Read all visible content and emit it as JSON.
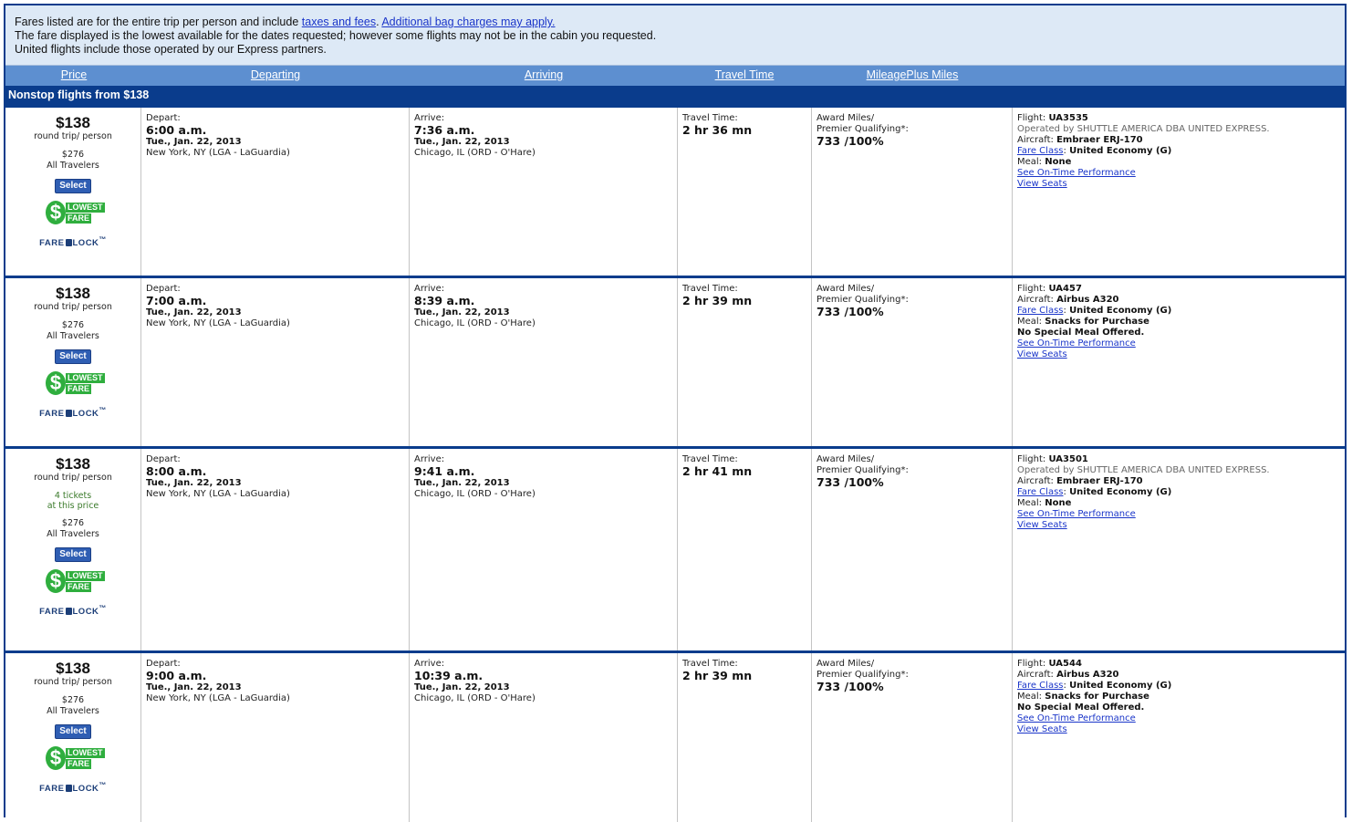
{
  "notice": {
    "line1_prefix": "Fares listed are for the entire trip per person and include ",
    "taxes_link": "taxes and fees",
    "line1_middle": ". ",
    "bag_link": "Additional bag charges may apply.",
    "line2": "The fare displayed is the lowest available for the dates requested; however some flights may not be in the cabin you requested.",
    "line3": "United flights include those operated by our Express partners."
  },
  "sort": {
    "price": "Price",
    "departing": "Departing",
    "arriving": "Arriving",
    "travel_time": "Travel Time",
    "miles": "MileagePlus Miles"
  },
  "section_title": "Nonstop flights from $138",
  "labels": {
    "per_person": "round trip/ person",
    "all_travelers": "All Travelers",
    "select": "Select",
    "lowest": "LOWEST",
    "fare": "FARE",
    "farelock_a": "FARE",
    "farelock_b": "LOCK",
    "farelock_tm": "™",
    "depart": "Depart:",
    "arrive": "Arrive:",
    "travel_time": "Travel Time:",
    "award_miles": "Award Miles/",
    "premier_qualifying": "Premier Qualifying*:",
    "flight": "Flight:",
    "aircraft": "Aircraft:",
    "fare_class": "Fare Class",
    "meal": "Meal:",
    "on_time": "See On-Time Performance",
    "view_seats": "View Seats"
  },
  "flights": [
    {
      "price": "$138",
      "total": "$276",
      "tickets_line1": "",
      "tickets_line2": "",
      "depart_time": "6:00 a.m.",
      "depart_date": "Tue., Jan. 22, 2013",
      "depart_airport": "New York, NY (LGA - LaGuardia)",
      "arrive_time": "7:36 a.m.",
      "arrive_date": "Tue., Jan. 22, 2013",
      "arrive_airport": "Chicago, IL (ORD - O'Hare)",
      "travel_time": "2 hr 36 mn",
      "miles": "733 /100%",
      "flight": "UA3535",
      "operated_by": "Operated by SHUTTLE AMERICA DBA UNITED EXPRESS.",
      "aircraft": "Embraer ERJ-170",
      "fare_class": "United Economy (G)",
      "meal": "None",
      "meal_note": ""
    },
    {
      "price": "$138",
      "total": "$276",
      "tickets_line1": "",
      "tickets_line2": "",
      "depart_time": "7:00 a.m.",
      "depart_date": "Tue., Jan. 22, 2013",
      "depart_airport": "New York, NY (LGA - LaGuardia)",
      "arrive_time": "8:39 a.m.",
      "arrive_date": "Tue., Jan. 22, 2013",
      "arrive_airport": "Chicago, IL (ORD - O'Hare)",
      "travel_time": "2 hr 39 mn",
      "miles": "733 /100%",
      "flight": "UA457",
      "operated_by": "",
      "aircraft": "Airbus A320",
      "fare_class": "United Economy (G)",
      "meal": "Snacks for Purchase",
      "meal_note": "No Special Meal Offered."
    },
    {
      "price": "$138",
      "total": "$276",
      "tickets_line1": "4 tickets",
      "tickets_line2": "at this price",
      "depart_time": "8:00 a.m.",
      "depart_date": "Tue., Jan. 22, 2013",
      "depart_airport": "New York, NY (LGA - LaGuardia)",
      "arrive_time": "9:41 a.m.",
      "arrive_date": "Tue., Jan. 22, 2013",
      "arrive_airport": "Chicago, IL (ORD - O'Hare)",
      "travel_time": "2 hr 41 mn",
      "miles": "733 /100%",
      "flight": "UA3501",
      "operated_by": "Operated by SHUTTLE AMERICA DBA UNITED EXPRESS.",
      "aircraft": "Embraer ERJ-170",
      "fare_class": "United Economy (G)",
      "meal": "None",
      "meal_note": ""
    },
    {
      "price": "$138",
      "total": "$276",
      "tickets_line1": "",
      "tickets_line2": "",
      "depart_time": "9:00 a.m.",
      "depart_date": "Tue., Jan. 22, 2013",
      "depart_airport": "New York, NY (LGA - LaGuardia)",
      "arrive_time": "10:39 a.m.",
      "arrive_date": "Tue., Jan. 22, 2013",
      "arrive_airport": "Chicago, IL (ORD - O'Hare)",
      "travel_time": "2 hr 39 mn",
      "miles": "733 /100%",
      "flight": "UA544",
      "operated_by": "",
      "aircraft": "Airbus A320",
      "fare_class": "United Economy (G)",
      "meal": "Snacks for Purchase",
      "meal_note": "No Special Meal Offered."
    }
  ]
}
